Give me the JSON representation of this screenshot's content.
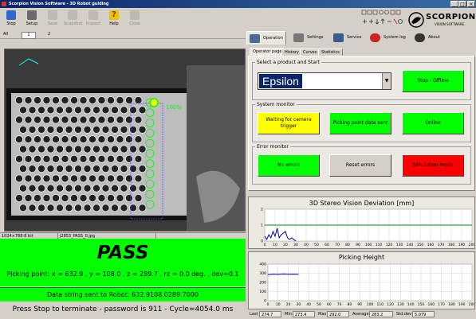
{
  "window": {
    "title": "Scorpion Vision Software - 3D Robot guiding"
  },
  "toolbar": {
    "stop": "Stop",
    "setup": "Setup",
    "save": "Save",
    "snapshot": "Snapshot",
    "inspect": "Inspect",
    "help": "Help",
    "close": "Close"
  },
  "zoom": {
    "all": "All",
    "v1": "1",
    "v2": "2"
  },
  "image_status": {
    "size": "1024×768-8 bit",
    "file": "j2853_PASS_0.jpg"
  },
  "overlay": {
    "percent": "100%"
  },
  "result": {
    "status": "PASS",
    "picking_point": "Picking point: x = 632.9 , y = 108.0 , z = 289.7 , rz = 0.0 deg. , dev=0.1",
    "data_string": "Data string sent to Robot: 632.9108.0289.7000",
    "press_stop": "Press Stop to terminate - password is 911 - Cycle=4054.0 ms"
  },
  "logo": {
    "brand": "SCORPION",
    "sub": "VISION SOFTWARE."
  },
  "main_tabs": {
    "operation": "Operation",
    "settings": "Settings",
    "service": "Service",
    "system_log": "System log",
    "about": "About"
  },
  "sub_tabs": {
    "operator_page": "Operator page",
    "history": "History",
    "curves": "Curves",
    "statistics": "Statistics"
  },
  "product": {
    "group_label": "Select a product and Start",
    "selected": "Epsilon",
    "stop_button": "Stop - Offline"
  },
  "system_monitor": {
    "group_label": "System monitor",
    "waiting": "Waiting for camera trigger",
    "picking_sent": "Picking point data sent",
    "online": "Online"
  },
  "error_monitor": {
    "group_label": "Error monitor",
    "no_errors": "No errors",
    "reset": "Reset errors",
    "simulation": "Simulation mode"
  },
  "colors": {
    "green": "#00ff00",
    "yellow": "#ffff00",
    "red": "#ff0000"
  },
  "chart_data": [
    {
      "type": "line",
      "title": "3D Stereo Vision Deviation [mm]",
      "xlim": [
        0,
        200
      ],
      "ylim": [
        0,
        2
      ],
      "x_ticks": [
        "0",
        "10",
        "20",
        "30",
        "40",
        "50",
        "60",
        "70",
        "80",
        "90",
        "100",
        "110",
        "120",
        "130",
        "140",
        "150",
        "160",
        "170",
        "180",
        "190",
        "200"
      ],
      "y_ticks": [
        "0",
        "1",
        "2"
      ],
      "grid": true,
      "series": [
        {
          "color": "#0000aa",
          "x": [
            0,
            2,
            4,
            6,
            8,
            10,
            12,
            14,
            16,
            18,
            20,
            22,
            24,
            26,
            28,
            30
          ],
          "y": [
            0.3,
            0.1,
            0.4,
            0.2,
            0.6,
            0.3,
            0.8,
            0.2,
            0.4,
            0.5,
            0.6,
            0.2,
            0.1,
            0.2,
            0.1,
            0.0
          ]
        },
        {
          "color": "#008000",
          "x": [
            0,
            200
          ],
          "y": [
            1.0,
            1.0
          ]
        }
      ]
    },
    {
      "type": "line",
      "title": "Picking Height",
      "xlim": [
        0,
        200
      ],
      "ylim": [
        0,
        400
      ],
      "x_ticks": [
        "0",
        "10",
        "20",
        "30",
        "40",
        "50",
        "60",
        "70",
        "80",
        "90",
        "100",
        "110",
        "120",
        "130",
        "140",
        "150",
        "160",
        "170",
        "180",
        "190",
        "200"
      ],
      "y_ticks": [
        "0",
        "100",
        "200",
        "300",
        "400"
      ],
      "grid": true,
      "series": [
        {
          "color": "#0000aa",
          "x": [
            0,
            5,
            10,
            15,
            20,
            25,
            30
          ],
          "y": [
            285,
            290,
            288,
            292,
            289,
            290,
            289
          ]
        }
      ]
    }
  ],
  "bottom_stats": {
    "last_label": "Last",
    "last": "274.7",
    "min_label": "Min",
    "min": "273.4",
    "max_label": "Max",
    "max": "292.0",
    "avg_label": "Average",
    "avg": "283.2",
    "std_label": "Std.dev",
    "std": "5.079"
  }
}
